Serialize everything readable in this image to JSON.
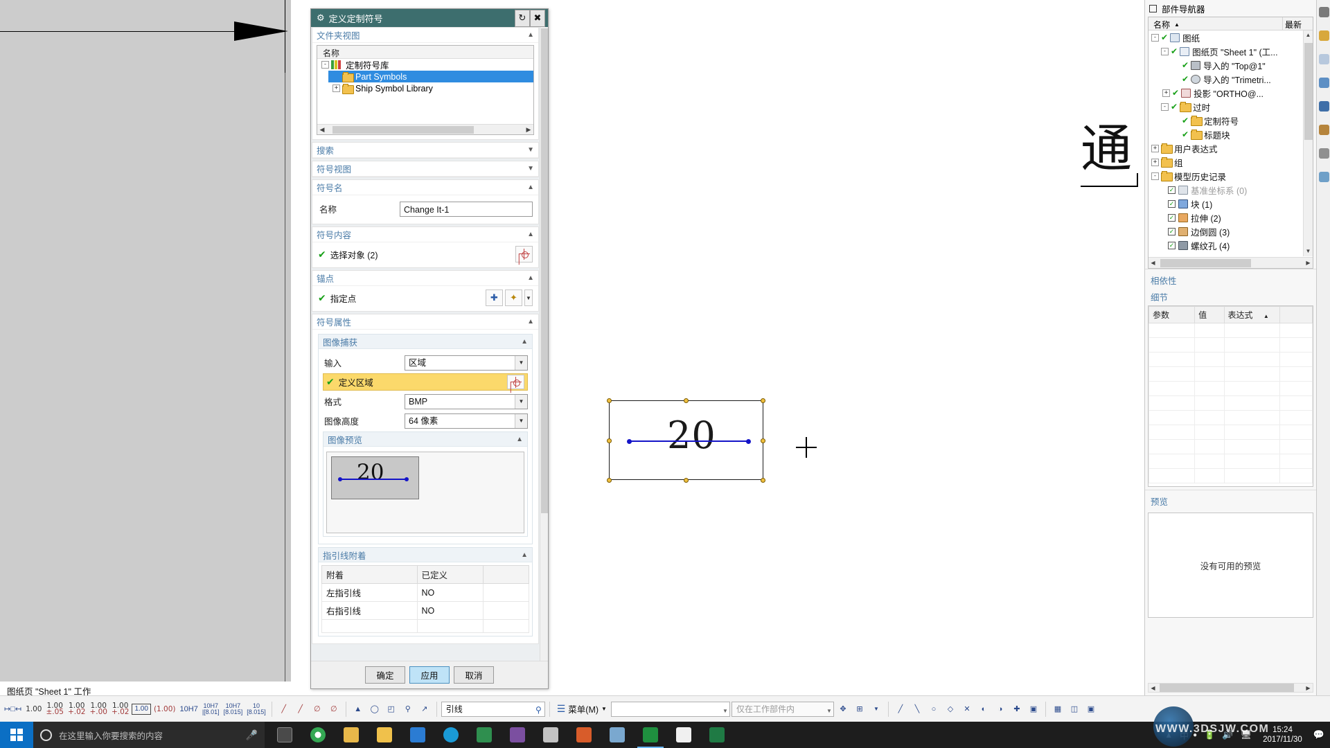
{
  "app": {
    "status_bar": "图纸页 \"Sheet 1\" 工作"
  },
  "canvas": {
    "big_glyph": "通",
    "symbol_value": "20"
  },
  "dialog": {
    "title": "定义定制符号",
    "gear_icon": "gear-icon",
    "reset_icon": "reset-icon",
    "close_icon": "close-icon",
    "sections": {
      "folder_view": {
        "label": "文件夹视图",
        "collapsed": false,
        "tree_header": "名称",
        "nodes": [
          {
            "label": "定制符号库",
            "expander": "-",
            "icon": "library-icon",
            "level": 0,
            "selected": false
          },
          {
            "label": "Part Symbols",
            "expander": "",
            "icon": "folder-icon",
            "level": 1,
            "selected": true
          },
          {
            "label": "Ship Symbol Library",
            "expander": "+",
            "icon": "folder-icon",
            "level": 1,
            "selected": false
          }
        ]
      },
      "search": {
        "label": "搜索",
        "collapsed": true
      },
      "symbol_view": {
        "label": "符号视图",
        "collapsed": true
      },
      "symbol_name": {
        "label": "符号名",
        "collapsed": false,
        "name_label": "名称",
        "name_value": "Change It-1"
      },
      "symbol_content": {
        "label": "符号内容",
        "collapsed": false,
        "select_objects_label": "选择对象 (2)",
        "select_objects_icon": "target-icon"
      },
      "anchor": {
        "label": "锚点",
        "collapsed": false,
        "specify_point_label": "指定点",
        "point_icon": "point-constructor-icon",
        "vector_icon": "vector-wand-icon"
      },
      "symbol_properties": {
        "label": "符号属性",
        "collapsed": false,
        "image_capture": {
          "label": "图像捕获",
          "collapsed": false,
          "input_label": "输入",
          "input_value": "区域",
          "define_region_label": "定义区域",
          "define_region_icon": "target-icon",
          "format_label": "格式",
          "format_value": "BMP",
          "image_height_label": "图像高度",
          "image_height_value": "64 像素",
          "preview": {
            "label": "图像预览",
            "collapsed": false,
            "thumb_value": "20"
          }
        },
        "leader_attach": {
          "label": "指引线附着",
          "collapsed": false,
          "columns": [
            "附着",
            "已定义",
            ""
          ],
          "rows": [
            [
              "左指引线",
              "NO",
              ""
            ],
            [
              "右指引线",
              "NO",
              ""
            ]
          ]
        }
      }
    },
    "buttons": {
      "ok": "确定",
      "apply": "应用",
      "cancel": "取消"
    }
  },
  "right_panel": {
    "title": "部件导航器",
    "tree_columns": [
      "名称",
      "最新"
    ],
    "sort_icon": "sort-asc-icon",
    "tree": [
      {
        "label": "图纸",
        "level": 0,
        "expander": "-",
        "check": "green",
        "icon": "sheet-icon",
        "dim": false
      },
      {
        "label": "图纸页 \"Sheet 1\" (工...",
        "level": 1,
        "expander": "-",
        "check": "green",
        "icon": "page-icon",
        "dim": false
      },
      {
        "label": "导入的 \"Top@1\"",
        "level": 2,
        "expander": "",
        "check": "green",
        "icon": "top-view-icon",
        "dim": false
      },
      {
        "label": "导入的 \"Trimetri...",
        "level": 2,
        "expander": "",
        "check": "green",
        "icon": "trimetric-icon",
        "dim": false
      },
      {
        "label": "投影 \"ORTHO@...",
        "level": 2,
        "expander": "+",
        "check": "green",
        "icon": "ortho-icon",
        "dim": false
      },
      {
        "label": "过时",
        "level": 1,
        "expander": "-",
        "check": "green",
        "icon": "folder-icon",
        "dim": false
      },
      {
        "label": "定制符号",
        "level": 2,
        "expander": "",
        "check": "green",
        "icon": "folder-icon",
        "dim": false
      },
      {
        "label": "标题块",
        "level": 2,
        "expander": "",
        "check": "green",
        "icon": "folder-icon",
        "dim": false
      },
      {
        "label": "用户表达式",
        "level": 0,
        "expander": "+",
        "check": "none",
        "icon": "expr-folder-icon",
        "dim": false
      },
      {
        "label": "组",
        "level": 0,
        "expander": "+",
        "check": "none",
        "icon": "folder-icon",
        "dim": false
      },
      {
        "label": "模型历史记录",
        "level": 0,
        "expander": "-",
        "check": "none",
        "icon": "folder-icon",
        "dim": false
      },
      {
        "label": "基准坐标系 (0)",
        "level": 1,
        "expander": "",
        "check": "box",
        "icon": "csys-icon",
        "dim": true
      },
      {
        "label": "块 (1)",
        "level": 1,
        "expander": "",
        "check": "box",
        "icon": "cube-icon",
        "dim": false
      },
      {
        "label": "拉伸 (2)",
        "level": 1,
        "expander": "",
        "check": "box",
        "icon": "extrude-icon",
        "dim": false
      },
      {
        "label": "边倒圆 (3)",
        "level": 1,
        "expander": "",
        "check": "box",
        "icon": "fillet-icon",
        "dim": false
      },
      {
        "label": "螺纹孔 (4)",
        "level": 1,
        "expander": "",
        "check": "box",
        "icon": "hole-icon",
        "dim": false
      }
    ],
    "dependency_label": "相依性",
    "details_label": "细节",
    "details_columns": [
      "参数",
      "值",
      "表达式"
    ],
    "details_sort_icon": "sort-asc-icon",
    "preview_label": "预览",
    "preview_empty_text": "没有可用的预览"
  },
  "bottom_toolbar": {
    "tolerance_items": [
      "1.00",
      "1.00\n±.05",
      "1.00\n+.00\n−.02",
      "1.00\n+.00\n−.00",
      "1.00\n+.02\n−.02"
    ],
    "boxed_value": "1.00",
    "paren_value": "(1.00)",
    "fit_values": [
      "10H7",
      "10H7",
      "10H7",
      "10"
    ],
    "menu_label": "菜单(M)",
    "menu_icon": "menu-icon",
    "filter_combo_value": "",
    "scope_combo_value": "仅在工作部件内",
    "search_placeholder": "引线",
    "search_icon": "search-icon"
  },
  "taskbar": {
    "start_icon": "windows-start-icon",
    "search_placeholder": "在这里输入你要搜索的内容",
    "cortana_icon": "cortana-circle-icon",
    "mic_icon": "microphone-icon",
    "task_view_icon": "task-view-icon",
    "ime_lang": "中",
    "ime_mode": "●",
    "clock_time": "15:24",
    "clock_date": "2017/11/30",
    "watermark": "WWW.3DSJW.COM",
    "tray_icons": [
      "battery-icon",
      "volume-icon",
      "network-icon",
      "app-icon"
    ]
  },
  "colors": {
    "dialog_title_bg": "#3d6e6e",
    "accent_blue": "#4a7ba7",
    "selection_blue": "#2f8ce0",
    "highlight_yellow": "#fbd96b",
    "check_green": "#18a018",
    "anchor_blue": "#1414c8",
    "start_blue": "#0b6fc4"
  }
}
